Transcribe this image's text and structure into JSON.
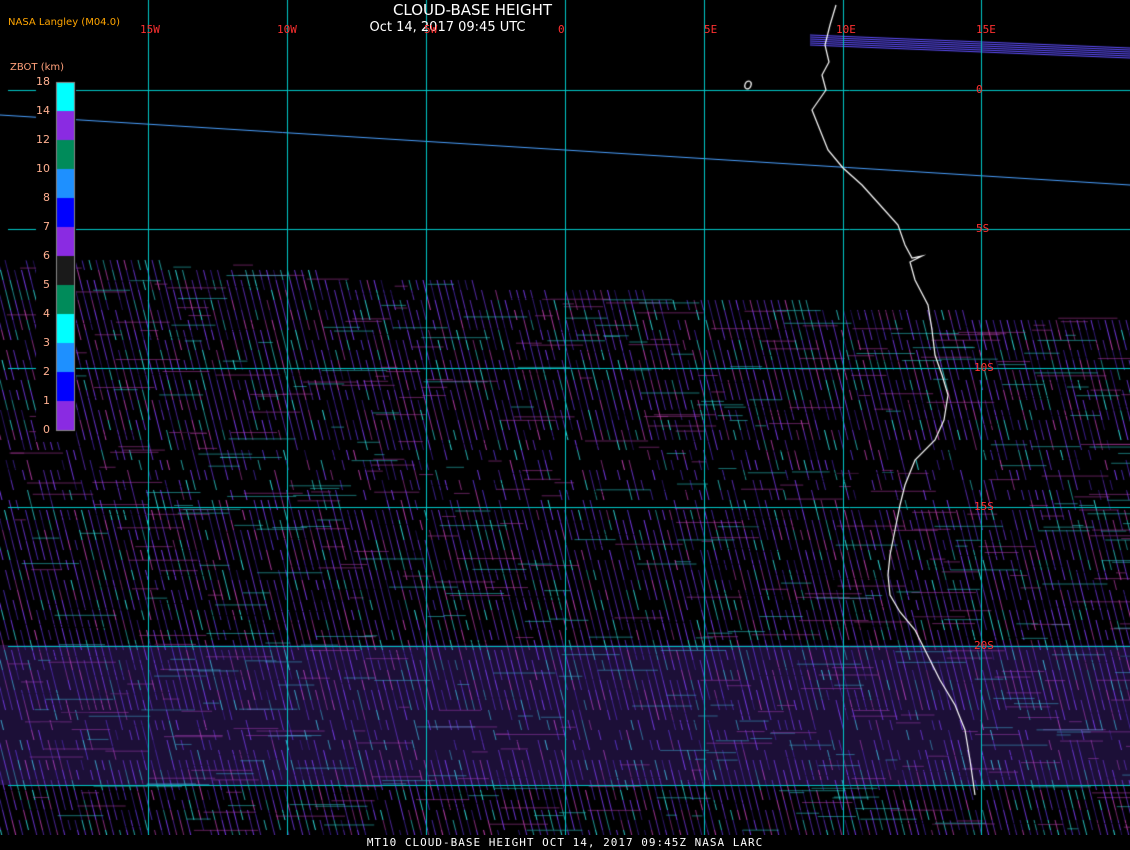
{
  "header": {
    "title": "CLOUD-BASE HEIGHT",
    "subtitle": "Oct 14, 2017 09:45 UTC",
    "credit": "NASA Langley (M04.0)"
  },
  "footer": {
    "text": "MT10  CLOUD-BASE HEIGHT   OCT 14, 2017 09:45Z   NASA LARC"
  },
  "legend": {
    "title": "ZBOT (km)",
    "ticks": [
      "18",
      "14",
      "12",
      "10",
      "8",
      "7",
      "6",
      "5",
      "4",
      "3",
      "2",
      "1",
      "0"
    ],
    "colors": [
      "#00ffff",
      "#8a2be2",
      "#008b5a",
      "#1e90ff",
      "#0000ff",
      "#8a2be2",
      "#1a1a1a",
      "#008b5a",
      "#00ffff",
      "#1e90ff",
      "#0000ff",
      "#8a2be2"
    ]
  },
  "grid": {
    "longitude_labels": [
      "15W",
      "10W",
      "5W",
      "0",
      "5E",
      "10E",
      "15E"
    ],
    "latitude_labels": [
      "0",
      "5S",
      "10S",
      "15S",
      "20S"
    ],
    "line_color": "#00c8c8",
    "label_color": "#ff3030"
  },
  "palette": {
    "purple": "#7a3cf0",
    "magenta": "#c040b0",
    "cyan": "#30e0e0",
    "coast": "#ffffff"
  }
}
